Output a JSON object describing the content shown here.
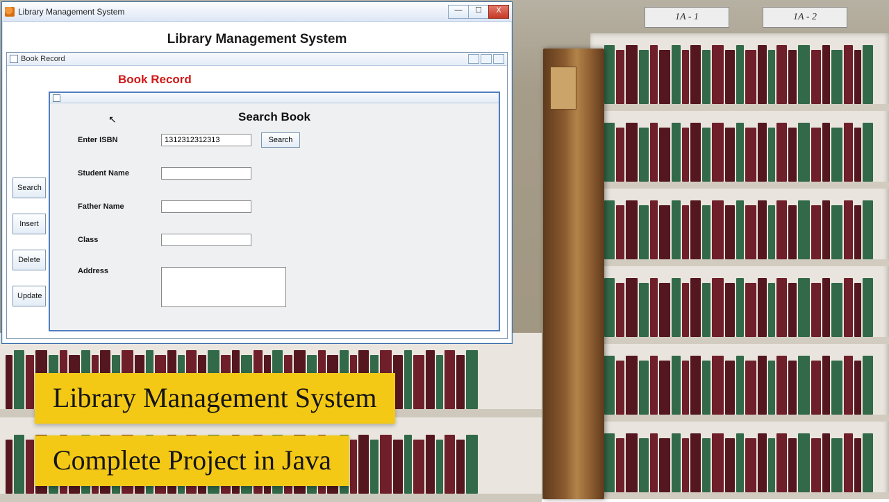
{
  "signs": {
    "a": "1A - 1",
    "b": "1A - 2"
  },
  "banners": {
    "line1": "Library Management System",
    "line2": "Complete Project in Java"
  },
  "window": {
    "title": "Library Management System",
    "app_title": "Library Management System"
  },
  "mdi": {
    "title": "Book Record",
    "heading": "Book Record"
  },
  "search_pane": {
    "title": "Search Book",
    "isbn_label": "Enter ISBN",
    "isbn_value": "1312312312313",
    "search_btn": "Search",
    "student_label": "Student Name",
    "student_value": "",
    "father_label": "Father Name",
    "father_value": "",
    "class_label": "Class",
    "class_value": "",
    "address_label": "Address",
    "address_value": ""
  },
  "side_buttons": {
    "search": "Search",
    "insert": "Insert",
    "delete": "Delete",
    "update": "Update"
  },
  "win_controls": {
    "min": "—",
    "max": "☐",
    "close": "X"
  }
}
